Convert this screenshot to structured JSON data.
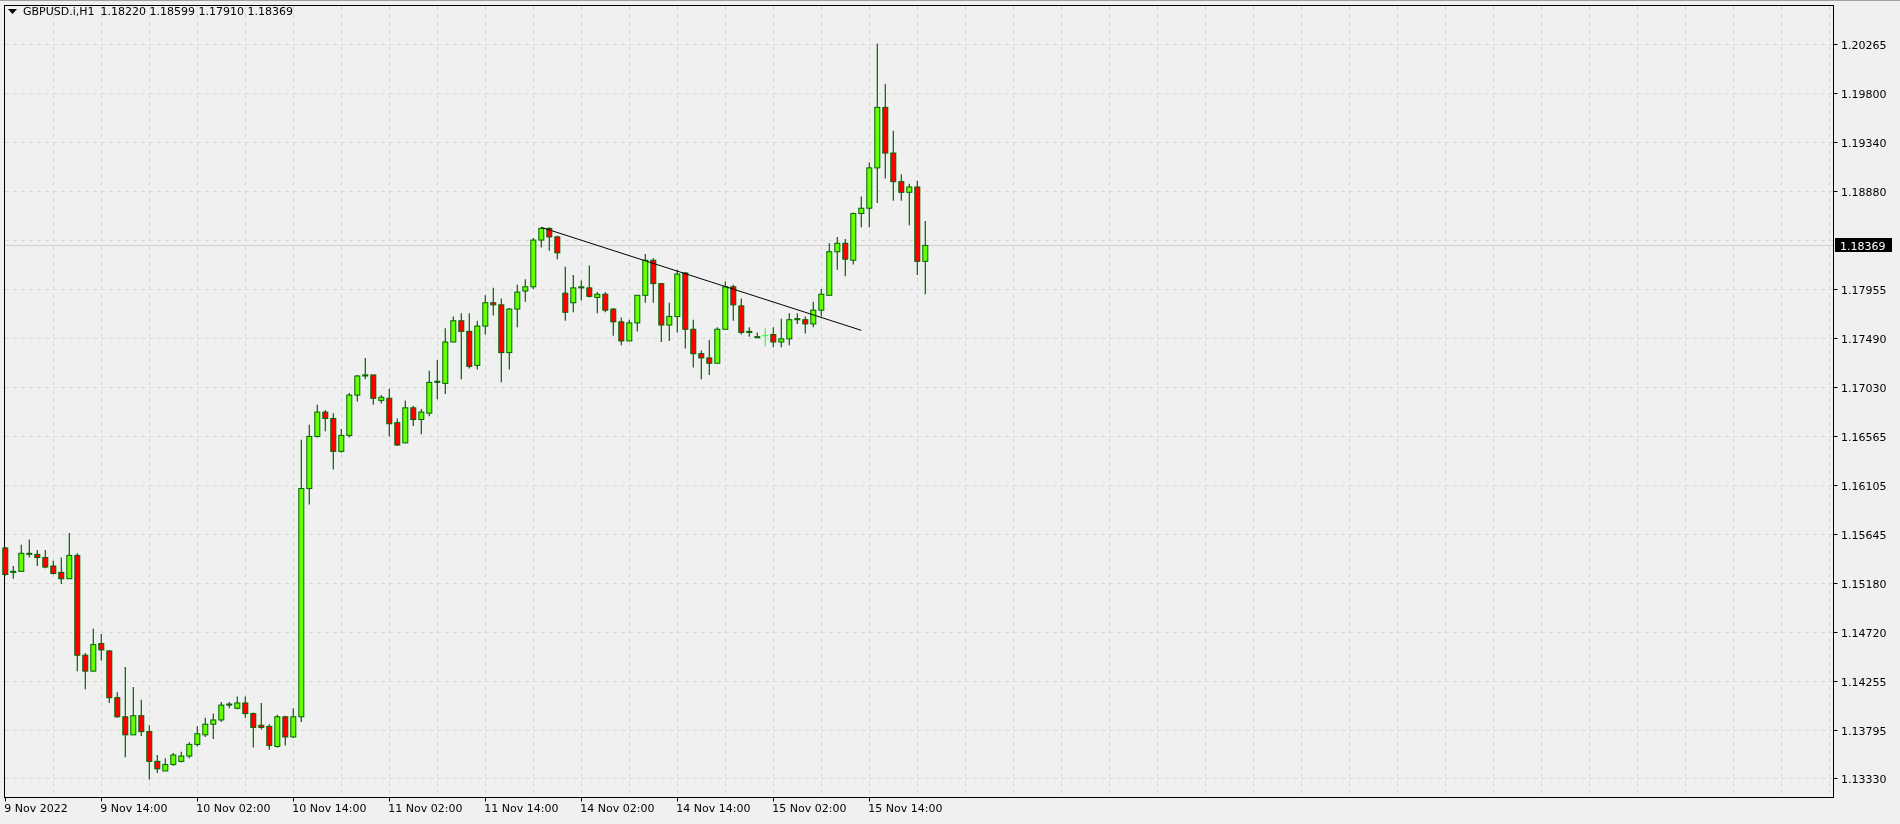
{
  "chart": {
    "symbol": "GBPUSD.i,H1",
    "ohlc": "1.18220 1.18599 1.17910 1.18369",
    "current_price": "1.18369",
    "price_labels": [
      "1.20265",
      "1.19800",
      "1.19340",
      "1.18880",
      "1.17955",
      "1.17490",
      "1.17030",
      "1.16565",
      "1.16105",
      "1.15645",
      "1.15180",
      "1.14720",
      "1.14255",
      "1.13795",
      "1.13330"
    ],
    "time_labels": [
      "9 Nov 2022",
      "9 Nov 14:00",
      "10 Nov 02:00",
      "10 Nov 14:00",
      "11 Nov 02:00",
      "11 Nov 14:00",
      "14 Nov 02:00",
      "14 Nov 14:00",
      "15 Nov 02:00",
      "15 Nov 14:00"
    ]
  }
}
